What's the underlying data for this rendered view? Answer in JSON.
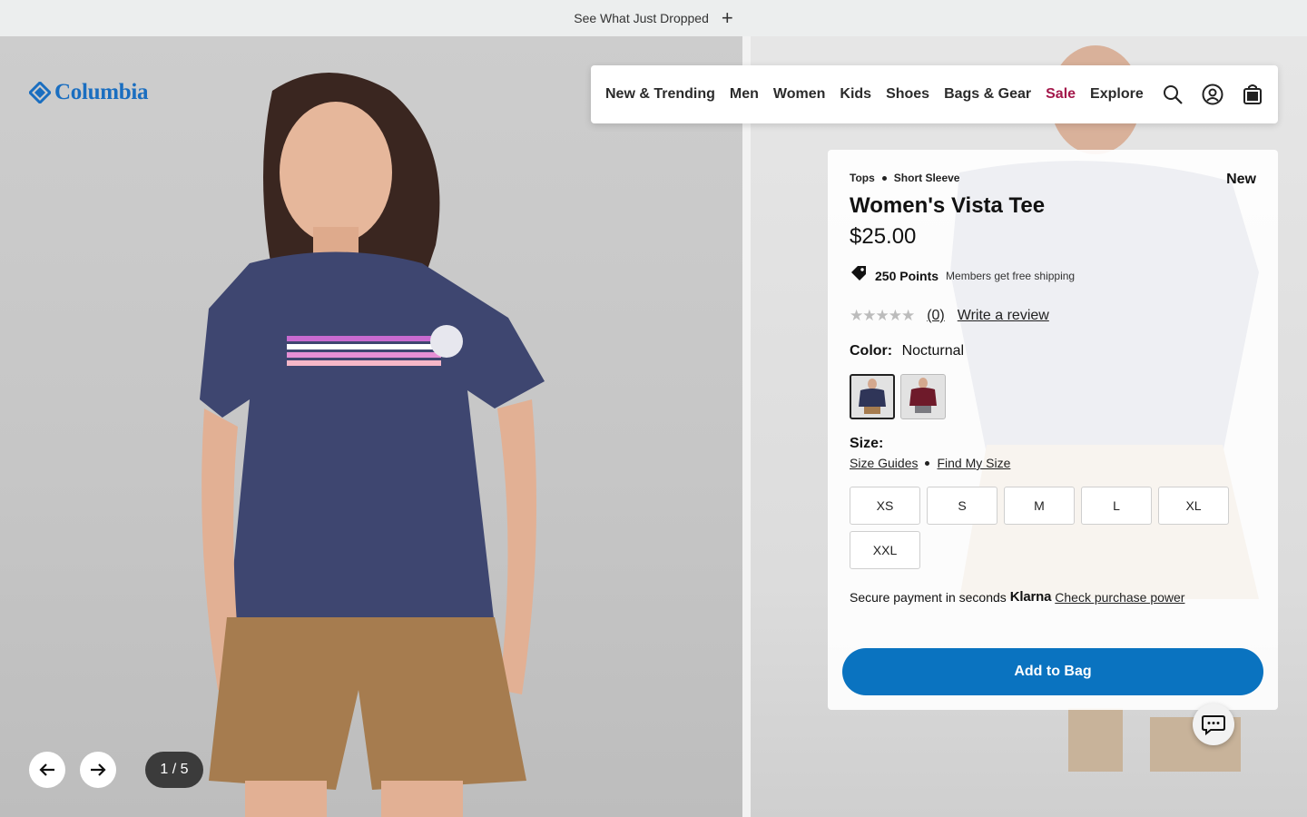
{
  "promo": {
    "text": "See What Just Dropped"
  },
  "logo": {
    "text": "Columbia"
  },
  "nav": {
    "items": [
      "New & Trending",
      "Men",
      "Women",
      "Kids",
      "Shoes",
      "Bags & Gear",
      "Sale",
      "Explore"
    ]
  },
  "product": {
    "breadcrumb": [
      "Tops",
      "Short Sleeve"
    ],
    "badge": "New",
    "title": "Women's Vista Tee",
    "price": "$25.00",
    "points": "250 Points",
    "points_note": "Members get free shipping",
    "rating_stars": 0,
    "rating_count": "(0)",
    "write_review": "Write a review",
    "color_label": "Color:",
    "color_value": "Nocturnal",
    "swatches": [
      {
        "name": "Nocturnal",
        "color": "#2f3558",
        "selected": true
      },
      {
        "name": "Red",
        "color": "#6e1a2a",
        "selected": false
      }
    ],
    "size_label": "Size:",
    "size_guides": "Size Guides",
    "find_my_size": "Find My Size",
    "sizes": [
      "XS",
      "S",
      "M",
      "L",
      "XL",
      "XXL"
    ],
    "klarna_text": "Secure payment in seconds",
    "klarna_brand": "Klarna",
    "klarna_link": "Check purchase power",
    "add_to_bag": "Add to Bag"
  },
  "gallery": {
    "counter": "1 / 5"
  },
  "colors": {
    "accent": "#0a73c0",
    "sale": "#a3174a",
    "brand": "#1a6ec0"
  }
}
